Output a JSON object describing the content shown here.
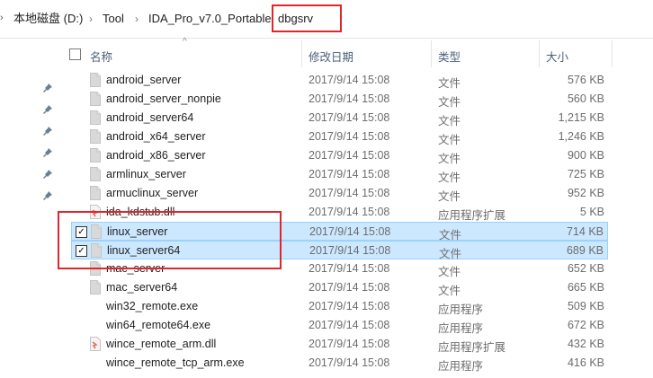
{
  "breadcrumb": {
    "items": [
      "本地磁盘 (D:)",
      "Tool",
      "IDA_Pro_v7.0_Portable",
      "dbgsrv"
    ],
    "separator": "›"
  },
  "columns": {
    "name": "名称",
    "date": "修改日期",
    "type": "类型",
    "size": "大小"
  },
  "files": [
    {
      "name": "android_server",
      "date": "2017/9/14 15:08",
      "type": "文件",
      "size": "576 KB",
      "icon": "blank-file-icon",
      "selected": false
    },
    {
      "name": "android_server_nonpie",
      "date": "2017/9/14 15:08",
      "type": "文件",
      "size": "560 KB",
      "icon": "blank-file-icon",
      "selected": false
    },
    {
      "name": "android_server64",
      "date": "2017/9/14 15:08",
      "type": "文件",
      "size": "1,215 KB",
      "icon": "blank-file-icon",
      "selected": false
    },
    {
      "name": "android_x64_server",
      "date": "2017/9/14 15:08",
      "type": "文件",
      "size": "1,246 KB",
      "icon": "blank-file-icon",
      "selected": false
    },
    {
      "name": "android_x86_server",
      "date": "2017/9/14 15:08",
      "type": "文件",
      "size": "900 KB",
      "icon": "blank-file-icon",
      "selected": false
    },
    {
      "name": "armlinux_server",
      "date": "2017/9/14 15:08",
      "type": "文件",
      "size": "725 KB",
      "icon": "blank-file-icon",
      "selected": false
    },
    {
      "name": "armuclinux_server",
      "date": "2017/9/14 15:08",
      "type": "文件",
      "size": "952 KB",
      "icon": "blank-file-icon",
      "selected": false
    },
    {
      "name": "ida_kdstub.dll",
      "date": "2017/9/14 15:08",
      "type": "应用程序扩展",
      "size": "5 KB",
      "icon": "dll-file-icon",
      "selected": false
    },
    {
      "name": "linux_server",
      "date": "2017/9/14 15:08",
      "type": "文件",
      "size": "714 KB",
      "icon": "blank-file-icon",
      "selected": true
    },
    {
      "name": "linux_server64",
      "date": "2017/9/14 15:08",
      "type": "文件",
      "size": "689 KB",
      "icon": "blank-file-icon",
      "selected": true
    },
    {
      "name": "mac_server",
      "date": "2017/9/14 15:08",
      "type": "文件",
      "size": "652 KB",
      "icon": "blank-file-icon",
      "selected": false
    },
    {
      "name": "mac_server64",
      "date": "2017/9/14 15:08",
      "type": "文件",
      "size": "665 KB",
      "icon": "blank-file-icon",
      "selected": false
    },
    {
      "name": "win32_remote.exe",
      "date": "2017/9/14 15:08",
      "type": "应用程序",
      "size": "509 KB",
      "icon": "exe-file-icon",
      "selected": false
    },
    {
      "name": "win64_remote64.exe",
      "date": "2017/9/14 15:08",
      "type": "应用程序",
      "size": "672 KB",
      "icon": "exe-file-icon",
      "selected": false
    },
    {
      "name": "wince_remote_arm.dll",
      "date": "2017/9/14 15:08",
      "type": "应用程序扩展",
      "size": "432 KB",
      "icon": "dll-file-icon",
      "selected": false
    },
    {
      "name": "wince_remote_tcp_arm.exe",
      "date": "2017/9/14 15:08",
      "type": "应用程序",
      "size": "416 KB",
      "icon": "exe-file-icon",
      "selected": false
    }
  ],
  "colors": {
    "selection_bg": "#cce8ff",
    "selection_border": "#99d1ff",
    "annotation": "#e0262a"
  }
}
